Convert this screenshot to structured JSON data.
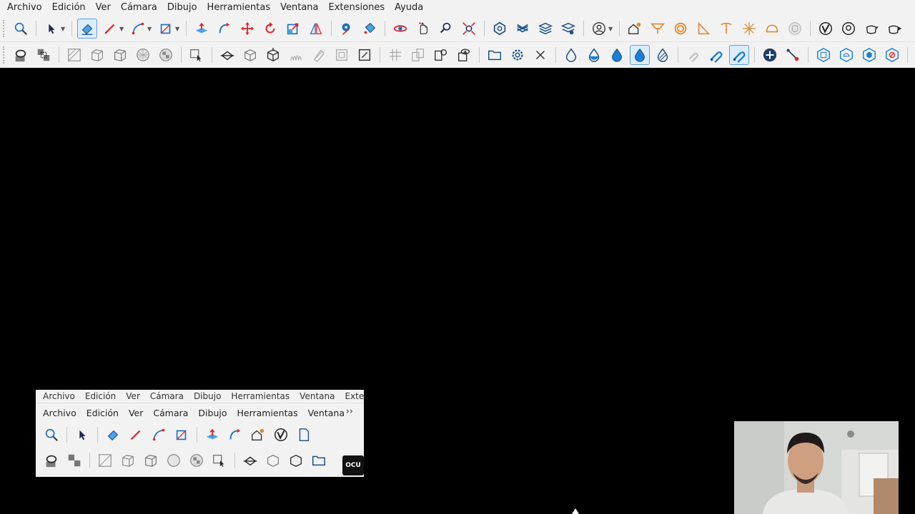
{
  "menubar": {
    "items": [
      "Archivo",
      "Edición",
      "Ver",
      "Cámara",
      "Dibujo",
      "Herramientas",
      "Ventana",
      "Extensiones",
      "Ayuda"
    ]
  },
  "thumbnail": {
    "ghost_menu": [
      "Archivo",
      "Edición",
      "Ver",
      "Cámara",
      "Dibujo",
      "Herramientas",
      "Ventana",
      "Extensio"
    ],
    "menu": [
      "Archivo",
      "Edición",
      "Ver",
      "Cámara",
      "Dibujo",
      "Herramientas",
      "Ventana"
    ],
    "more_label": "››",
    "ocu_label": "OCU"
  },
  "icons": {
    "toolbar1": [
      "zoom-icon",
      "select-icon",
      "eraser-icon",
      "pencil-icon",
      "arc-icon",
      "rectangle-icon",
      "push-pull-icon",
      "follow-me-icon",
      "move-icon",
      "rotate-icon",
      "scale-icon",
      "flip-icon",
      "tape-measure-icon",
      "paint-bucket-icon",
      "orbit-icon",
      "pan-icon",
      "zoom-window-icon",
      "zoom-extents-icon",
      "warehouse-icon",
      "stack-icon",
      "layers-icon",
      "layers-gear-icon",
      "user-icon",
      "house-settings-icon",
      "lamp-icon",
      "ring-icon",
      "triangle-icon",
      "ceiling-light-icon",
      "sparkle-icon",
      "helmet-icon",
      "box-icon",
      "vray-icon",
      "render-icon",
      "teapot-icon",
      "teapot-play-icon"
    ],
    "toolbar2": [
      "shadow-icon",
      "xray-icon",
      "wireframe-icon",
      "hidden-line-icon",
      "shaded-icon",
      "textured-icon",
      "monochrome-icon",
      "section-plane-icon",
      "section-cut-icon",
      "sandbox-grid-icon",
      "sandbox-smooth-icon",
      "sandbox-stamp-icon",
      "sandbox-drape-icon",
      "grass-icon",
      "solid-outer-icon",
      "intersect-icon",
      "union-icon",
      "split-icon",
      "trim-icon",
      "view-eye-icon",
      "folder-icon",
      "settings-gear-icon",
      "close-x-icon",
      "drop-outline-icon",
      "drop-half-icon",
      "drop-filled-icon",
      "drop-selected-icon",
      "drop-stripes-icon",
      "magnet-off-icon",
      "magnet-icon",
      "magnet-active-icon",
      "add-circle-icon",
      "connector-icon",
      "hexagon-a-icon",
      "hexagon-b-icon",
      "hexagon-c-icon",
      "hexagon-d-icon",
      "arrows-red-icon",
      "refresh-red-icon"
    ]
  },
  "colors": {
    "toolbar_bg": "#f2f2f2",
    "viewport_bg": "#000000",
    "accent_red": "#e0242c",
    "accent_blue": "#1a7fd8",
    "accent_orange": "#e08a2c",
    "navy": "#1e3f66"
  }
}
